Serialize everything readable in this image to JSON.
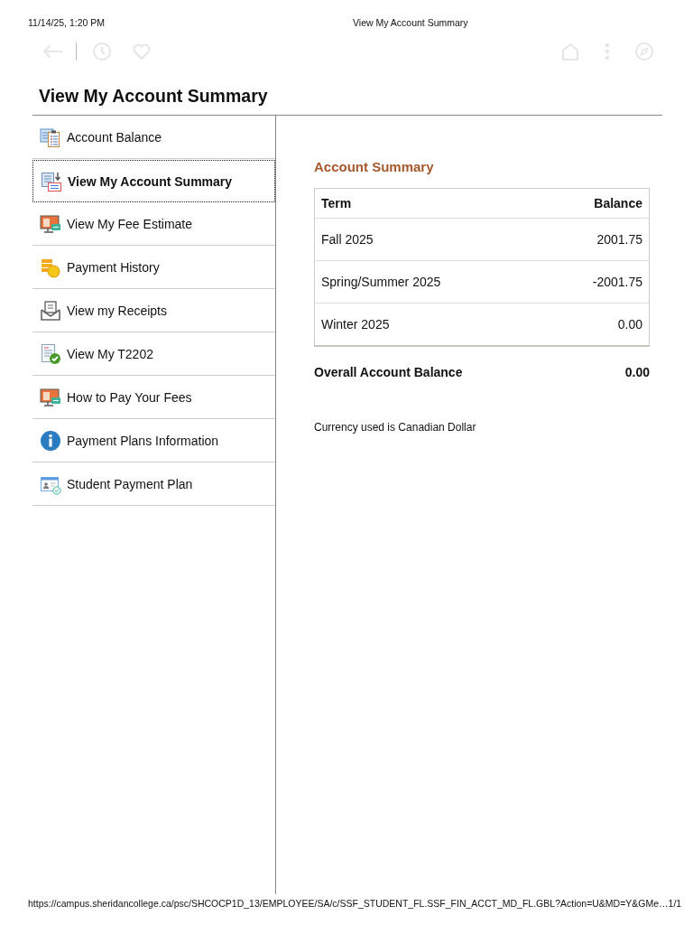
{
  "print_header": {
    "datetime": "11/14/25, 1:20 PM",
    "title": "View My Account Summary"
  },
  "page": {
    "title": "View My Account Summary"
  },
  "sidebar": {
    "items": [
      {
        "label": "Account Balance",
        "kind": "clipboard",
        "selected": false
      },
      {
        "label": "View My Account Summary",
        "kind": "summary",
        "selected": true
      },
      {
        "label": "View My Fee Estimate",
        "kind": "monitor",
        "selected": false
      },
      {
        "label": "Payment History",
        "kind": "coins",
        "selected": false
      },
      {
        "label": "View my Receipts",
        "kind": "envelope",
        "selected": false
      },
      {
        "label": "View My T2202",
        "kind": "certificate",
        "selected": false
      },
      {
        "label": "How to Pay Your Fees",
        "kind": "monitor",
        "selected": false
      },
      {
        "label": "Payment Plans Information",
        "kind": "info",
        "selected": false
      },
      {
        "label": "Student Payment Plan",
        "kind": "card",
        "selected": false
      }
    ]
  },
  "account_summary": {
    "title": "Account Summary",
    "table": {
      "columns": [
        "Term",
        "Balance"
      ],
      "rows": [
        {
          "term": "Fall 2025",
          "balance": "2001.75"
        },
        {
          "term": "Spring/Summer 2025",
          "balance": "-2001.75"
        },
        {
          "term": "Winter 2025",
          "balance": "0.00"
        }
      ]
    },
    "total": {
      "label": "Overall Account Balance",
      "value": "0.00"
    },
    "note": "Currency used is Canadian Dollar"
  },
  "print_footer": {
    "url": "https://campus.sheridancollege.ca/psc/SHCOCP1D_13/EMPLOYEE/SA/c/SSF_STUDENT_FL.SSF_FIN_ACCT_MD_FL.GBL?Action=U&MD=Y&GMe…",
    "page": "1/1"
  }
}
